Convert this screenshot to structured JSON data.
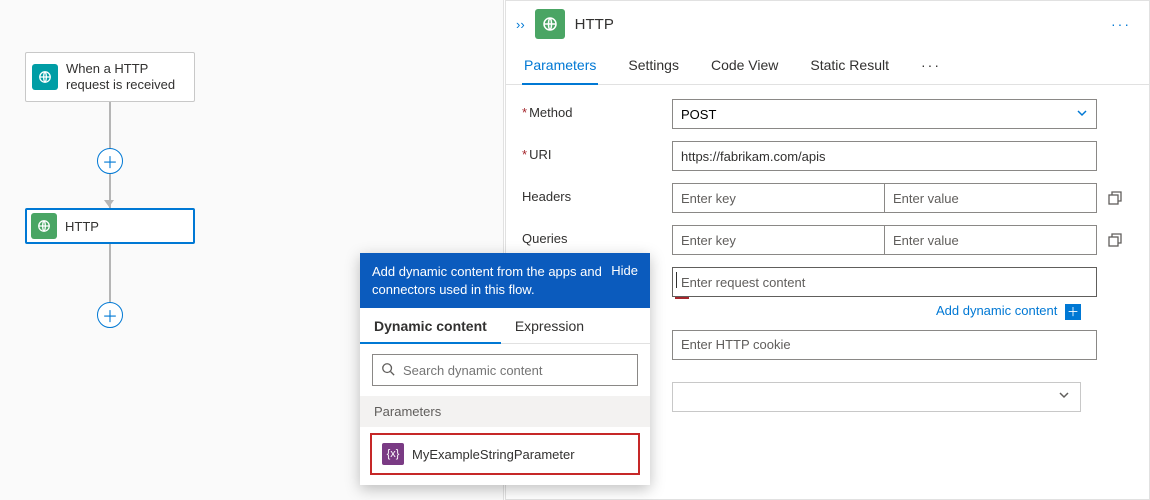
{
  "canvas": {
    "trigger": {
      "label": "When a HTTP request is received",
      "icon": "http-trigger-icon"
    },
    "action": {
      "label": "HTTP",
      "icon": "http-action-icon"
    }
  },
  "panel": {
    "title": "HTTP",
    "tabs": {
      "parameters": "Parameters",
      "settings": "Settings",
      "code": "Code View",
      "static": "Static Result",
      "more": "···"
    },
    "fields": {
      "method": {
        "label": "Method",
        "value": "POST"
      },
      "uri": {
        "label": "URI",
        "value": "https://fabrikam.com/apis"
      },
      "headers": {
        "label": "Headers",
        "key_ph": "Enter key",
        "val_ph": "Enter value"
      },
      "queries": {
        "label": "Queries",
        "key_ph": "Enter key",
        "val_ph": "Enter value"
      },
      "body": {
        "placeholder": "Enter request content"
      },
      "cookie": {
        "placeholder": "Enter HTTP cookie"
      }
    },
    "dynamic_hint": "Add dynamic content"
  },
  "popover": {
    "message": "Add dynamic content from the apps and connectors used in this flow.",
    "hide": "Hide",
    "tabs": {
      "dynamic": "Dynamic content",
      "expression": "Expression"
    },
    "search_ph": "Search dynamic content",
    "section": "Parameters",
    "item": "MyExampleStringParameter"
  }
}
